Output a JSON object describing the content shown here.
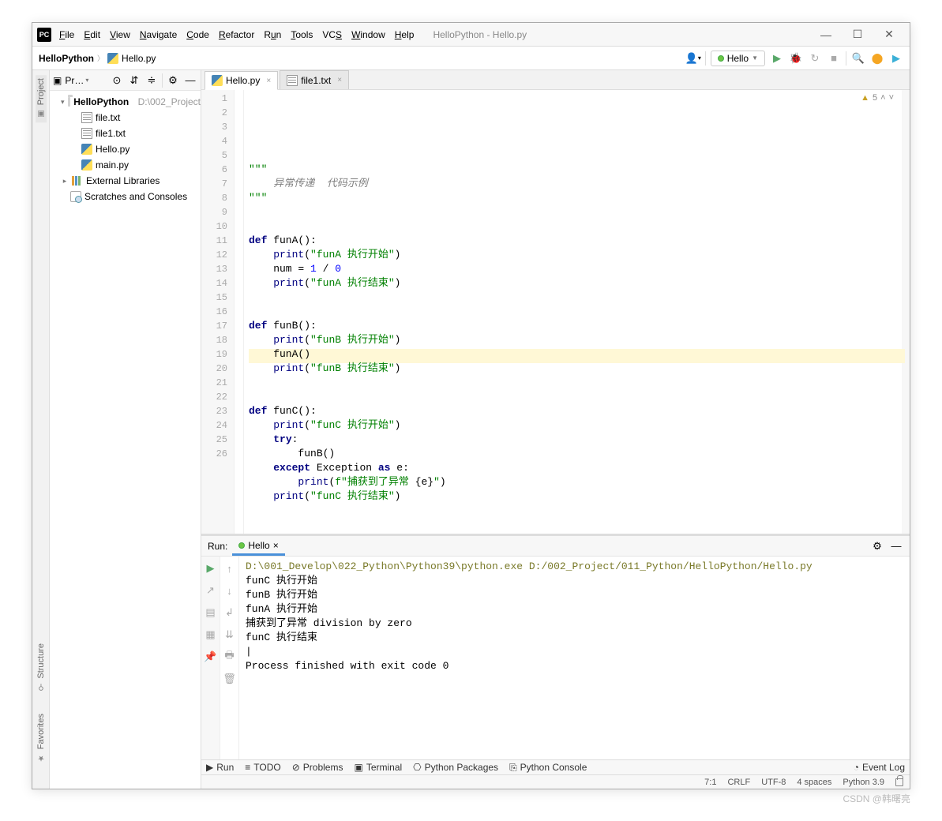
{
  "window": {
    "title": "HelloPython - Hello.py",
    "logo": "PC"
  },
  "menu": {
    "file": "File",
    "edit": "Edit",
    "view": "View",
    "navigate": "Navigate",
    "code": "Code",
    "refactor": "Refactor",
    "run": "Run",
    "tools": "Tools",
    "vcs": "VCS",
    "window": "Window",
    "help": "Help"
  },
  "breadcrumb": {
    "project": "HelloPython",
    "file": "Hello.py"
  },
  "runconfig": {
    "name": "Hello"
  },
  "warnings": {
    "count": "5"
  },
  "project_panel": {
    "label": "Pr…",
    "root": "HelloPython",
    "root_path": "D:\\002_Project",
    "files": [
      "file.txt",
      "file1.txt",
      "Hello.py",
      "main.py"
    ],
    "external": "External Libraries",
    "scratches": "Scratches and Consoles"
  },
  "tabs": {
    "t1": "Hello.py",
    "t2": "file1.txt"
  },
  "code_lines": [
    {
      "n": "1",
      "html": "<span class='c-str'>\"\"\"</span>"
    },
    {
      "n": "2",
      "html": "<span class='c-com'>    异常传递  代码示例</span>"
    },
    {
      "n": "3",
      "html": "<span class='c-str'>\"\"\"</span>"
    },
    {
      "n": "4",
      "html": ""
    },
    {
      "n": "5",
      "html": ""
    },
    {
      "n": "6",
      "html": "<span class='c-kw'>def</span> funA():"
    },
    {
      "n": "7",
      "html": "    <span class='c-bi'>print</span>(<span class='c-str'>\"funA 执行开始\"</span>)"
    },
    {
      "n": "8",
      "html": "    num = <span class='c-num'>1</span> / <span class='c-num'>0</span>"
    },
    {
      "n": "9",
      "html": "    <span class='c-bi'>print</span>(<span class='c-str'>\"funA 执行结束\"</span>)"
    },
    {
      "n": "10",
      "html": ""
    },
    {
      "n": "11",
      "html": ""
    },
    {
      "n": "12",
      "html": "<span class='c-kw'>def</span> funB():"
    },
    {
      "n": "13",
      "html": "    <span class='c-bi'>print</span>(<span class='c-str'>\"funB 执行开始\"</span>)"
    },
    {
      "n": "14",
      "html": "    funA()"
    },
    {
      "n": "15",
      "html": "    <span class='c-bi'>print</span>(<span class='c-str'>\"funB 执行结束\"</span>)"
    },
    {
      "n": "16",
      "html": ""
    },
    {
      "n": "17",
      "html": ""
    },
    {
      "n": "18",
      "html": "<span class='c-kw'>def</span> funC():"
    },
    {
      "n": "19",
      "html": "    <span class='c-bi'>print</span>(<span class='c-str'>\"funC 执行开始\"</span>)"
    },
    {
      "n": "20",
      "html": "    <span class='c-kw'>try</span>:"
    },
    {
      "n": "21",
      "html": "        funB()"
    },
    {
      "n": "22",
      "html": "    <span class='c-kw'>except</span> Exception <span class='c-kw'>as</span> e:"
    },
    {
      "n": "23",
      "html": "        <span class='c-bi'>print</span>(<span class='c-fstr'>f\"捕获到了异常 </span>{e}<span class='c-fstr'>\"</span>)"
    },
    {
      "n": "24",
      "html": "    <span class='c-bi'>print</span>(<span class='c-str'>\"funC 执行结束\"</span>)"
    },
    {
      "n": "25",
      "html": ""
    },
    {
      "n": "26",
      "html": ""
    }
  ],
  "run_panel": {
    "label": "Run:",
    "tab": "Hello",
    "console": [
      {
        "cls": "path",
        "t": "D:\\001_Develop\\022_Python\\Python39\\python.exe D:/002_Project/011_Python/HelloPython/Hello.py"
      },
      {
        "cls": "",
        "t": "funC 执行开始"
      },
      {
        "cls": "",
        "t": "funB 执行开始"
      },
      {
        "cls": "",
        "t": "funA 执行开始"
      },
      {
        "cls": "",
        "t": "捕获到了异常 division by zero"
      },
      {
        "cls": "",
        "t": "funC 执行结束"
      },
      {
        "cls": "",
        "t": "|"
      },
      {
        "cls": "exit",
        "t": "Process finished with exit code 0"
      }
    ]
  },
  "bottom_tabs": {
    "run": "Run",
    "todo": "TODO",
    "problems": "Problems",
    "terminal": "Terminal",
    "pypkg": "Python Packages",
    "pycon": "Python Console",
    "eventlog": "Event Log"
  },
  "left_rail": {
    "project": "Project",
    "structure": "Structure",
    "favorites": "Favorites"
  },
  "status": {
    "pos": "7:1",
    "eol": "CRLF",
    "enc": "UTF-8",
    "indent": "4 spaces",
    "py": "Python 3.9"
  },
  "watermark": "CSDN @韩曙亮"
}
